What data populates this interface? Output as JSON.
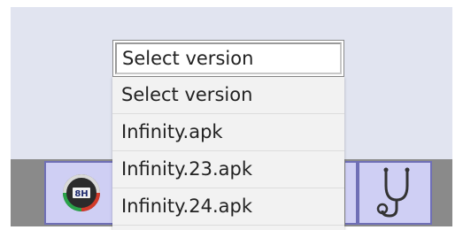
{
  "select": {
    "value": "Select version",
    "options": [
      "Select version",
      "Infinity.apk",
      "Infinity.23.apk",
      "Infinity.24.apk"
    ]
  },
  "toolbar": {
    "left_icon": "meter-gauge-icon",
    "right_icon": "stethoscope-icon",
    "meter_text": "8H"
  },
  "colors": {
    "screen_bg": "#e1e4f0",
    "toolbar_bg": "#8a8a8a",
    "button_bg": "#cfcff4",
    "button_border": "#6f6fb6"
  }
}
